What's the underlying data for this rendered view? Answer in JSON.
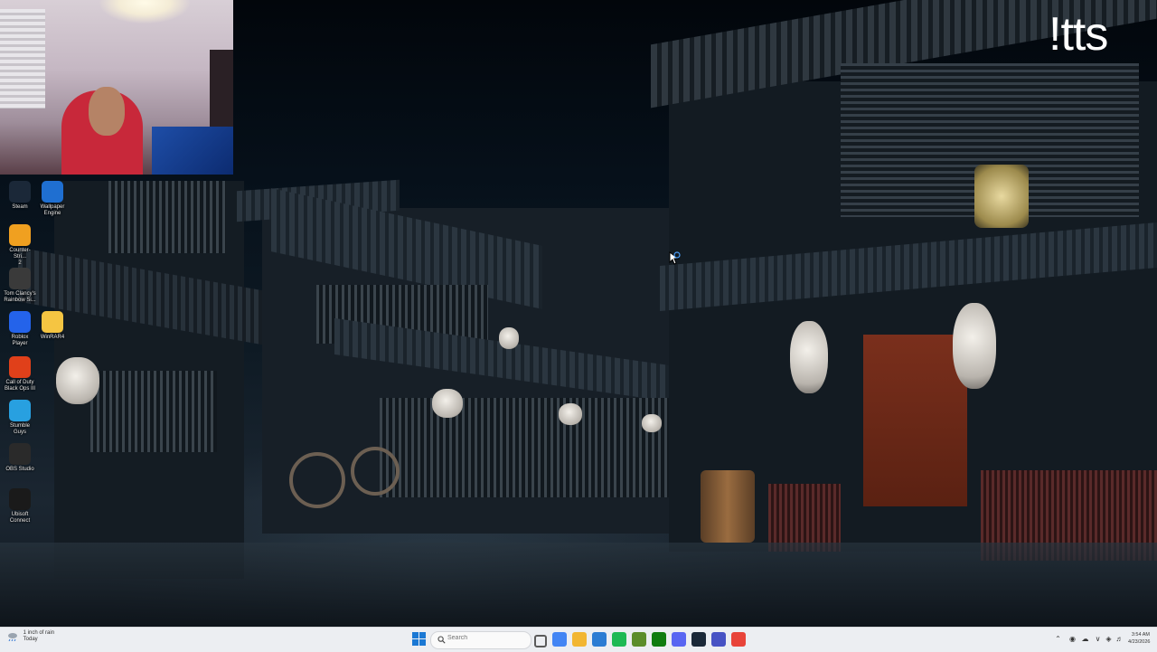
{
  "stream_overlay": {
    "logo_text": "!tts"
  },
  "desktop": {
    "icons": [
      {
        "label": "Steam",
        "icon": "steam-icon",
        "color": "#1b2838"
      },
      {
        "label": "Wallpaper\nEngine",
        "icon": "wallpaper-engine-icon",
        "color": "#1f6fd1"
      },
      {
        "label": "Counter-Stri...\n2",
        "icon": "counter-strike-icon",
        "color": "#f0a020"
      },
      {
        "label": "Tom Clancy's\nRainbow Si...",
        "icon": "rainbow-six-icon",
        "color": "#3a3a3a"
      },
      {
        "label": "Roblox\nPlayer",
        "icon": "roblox-icon",
        "color": "#2463ea"
      },
      {
        "label": "WinRAR4",
        "icon": "folder-icon",
        "color": "#f5c542"
      },
      {
        "label": "Call of Duty\nBlack Ops III",
        "icon": "call-of-duty-icon",
        "color": "#e0401a"
      },
      {
        "label": "Stumble\nGuys",
        "icon": "stumble-guys-icon",
        "color": "#28a0e0"
      },
      {
        "label": "OBS Studio",
        "icon": "obs-studio-icon",
        "color": "#2a2a2a"
      },
      {
        "label": "Ubisoft\nConnect",
        "icon": "ubisoft-connect-icon",
        "color": "#1a1a1a"
      }
    ]
  },
  "taskbar": {
    "weather": {
      "line1": "1 inch of rain",
      "line2": "Today",
      "icon": "rain-cloud-icon"
    },
    "search": {
      "placeholder": "Search"
    },
    "pinned": [
      {
        "name": "task-view-icon",
        "color": "#5a5a5a"
      },
      {
        "name": "chrome-icon",
        "color": "#4285f4"
      },
      {
        "name": "file-explorer-icon",
        "color": "#f2b632"
      },
      {
        "name": "mail-icon",
        "color": "#2b7cd3"
      },
      {
        "name": "spotify-icon",
        "color": "#1db954"
      },
      {
        "name": "minecraft-icon",
        "color": "#5c8d2a"
      },
      {
        "name": "xbox-icon",
        "color": "#107c10"
      },
      {
        "name": "discord-icon",
        "color": "#5865f2"
      },
      {
        "name": "steam-taskbar-icon",
        "color": "#1b2838"
      },
      {
        "name": "discord-canary-icon",
        "color": "#4752c4"
      },
      {
        "name": "chrome-canary-icon",
        "color": "#e8443a"
      }
    ],
    "clock": {
      "time": "3:54 AM",
      "date": "4/23/2026"
    }
  }
}
